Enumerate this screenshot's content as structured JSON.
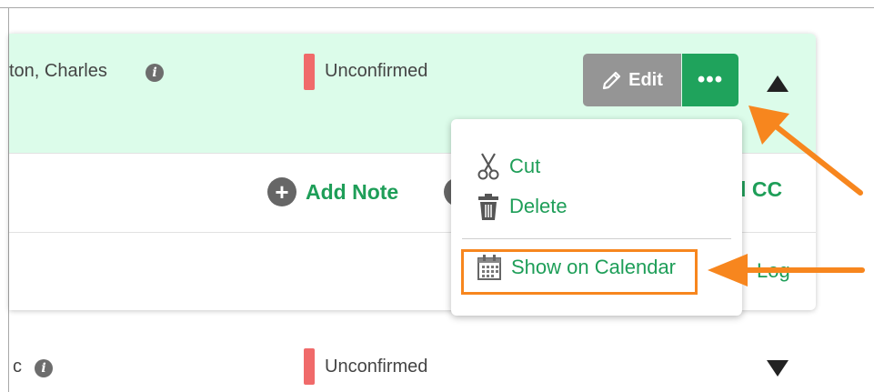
{
  "row_expanded": {
    "name": "ton, Charles",
    "info_icon_glyph": "i",
    "status": "Unconfirmed",
    "status_color": "#f06a6a",
    "edit_label": "Edit",
    "more_glyph": "•••"
  },
  "actions": {
    "add_note_label": "Add Note",
    "plus_glyph": "+",
    "add_cc_label": "ld CC",
    "log_label": "Log"
  },
  "dropdown": {
    "items": [
      {
        "label": "Cut",
        "icon": "scissors-icon"
      },
      {
        "label": "Delete",
        "icon": "trash-icon"
      },
      {
        "label": "Show on Calendar",
        "icon": "calendar-icon"
      }
    ],
    "highlighted_item": "Show on Calendar",
    "highlight_color": "#f7861e"
  },
  "row_collapsed": {
    "name": "c",
    "info_icon_glyph": "i",
    "status": "Unconfirmed"
  },
  "colors": {
    "accent_green": "#1e9e58",
    "row_highlight": "#dcfcea",
    "annotation_orange": "#f7861e"
  }
}
